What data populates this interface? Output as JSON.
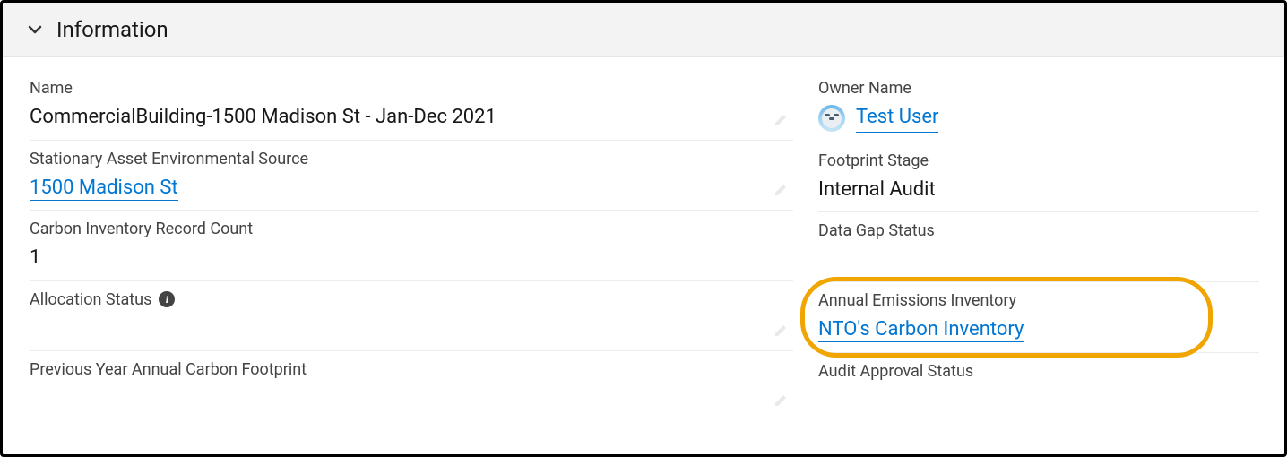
{
  "section": {
    "title": "Information"
  },
  "left": {
    "name_label": "Name",
    "name_value": "CommercialBuilding-1500 Madison St - Jan-Dec 2021",
    "source_label": "Stationary Asset Environmental Source",
    "source_link": "1500 Madison St",
    "record_count_label": "Carbon Inventory Record Count",
    "record_count_value": "1",
    "allocation_label": "Allocation Status",
    "allocation_value": "",
    "prev_year_label": "Previous Year Annual Carbon Footprint",
    "prev_year_value": ""
  },
  "right": {
    "owner_label": "Owner Name",
    "owner_link": "Test User",
    "footprint_stage_label": "Footprint Stage",
    "footprint_stage_value": "Internal Audit",
    "data_gap_label": "Data Gap Status",
    "data_gap_value": "",
    "emissions_label": "Annual Emissions Inventory",
    "emissions_link": "NTO's Carbon Inventory",
    "audit_label": "Audit Approval Status",
    "audit_value": ""
  },
  "icons": {
    "chevron_down": "chevron-down-icon",
    "info": "info-icon",
    "edit": "edit-icon",
    "avatar": "avatar-icon"
  }
}
